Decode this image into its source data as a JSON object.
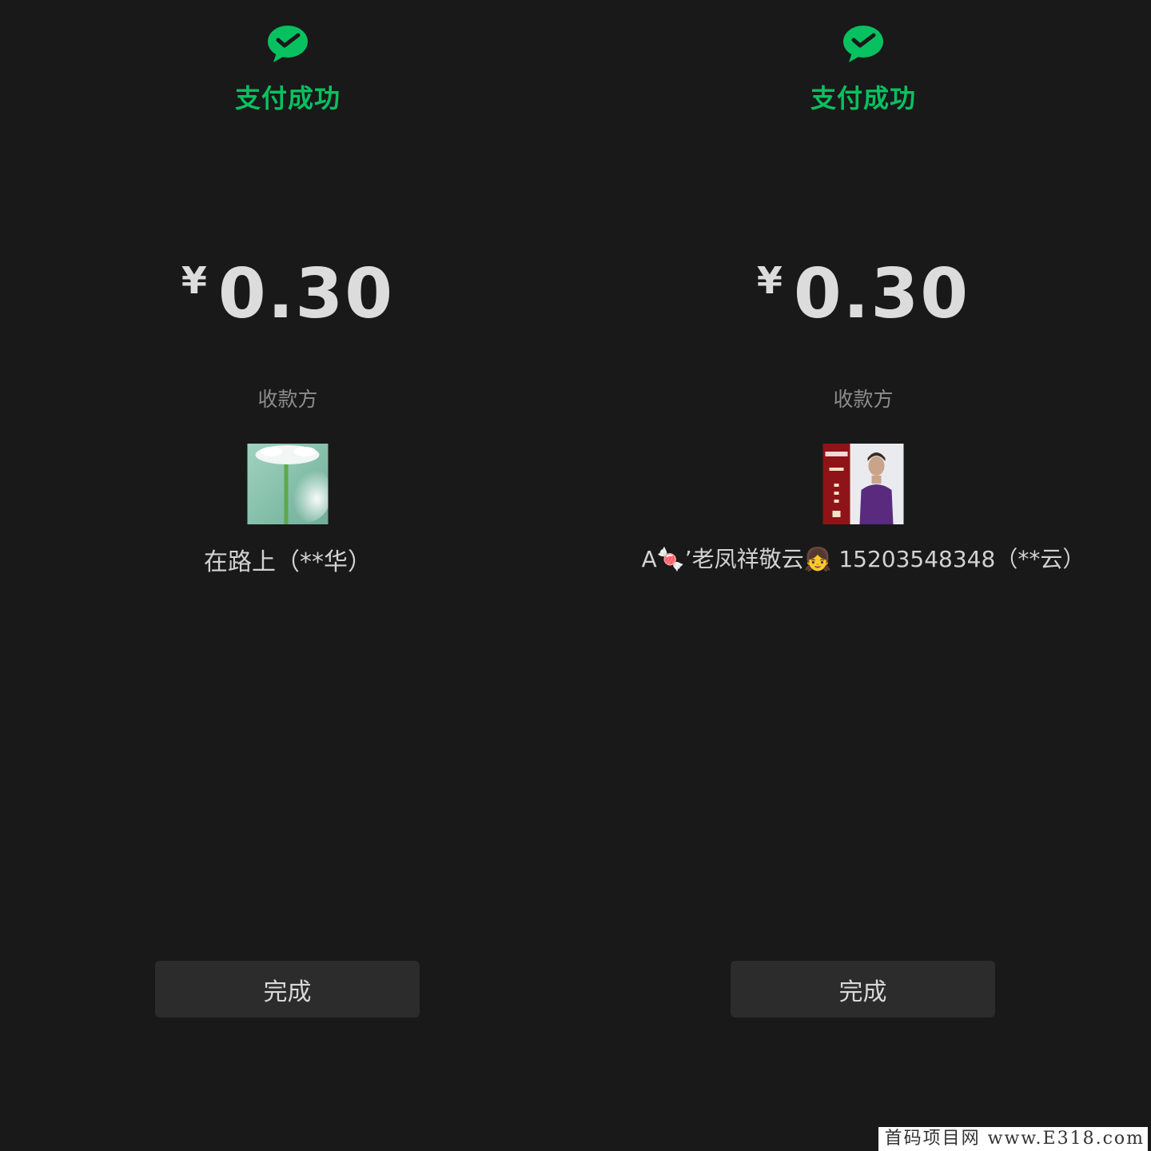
{
  "colors": {
    "background": "#191919",
    "success_green": "#07c160",
    "button_bg": "#2c2c2c",
    "label_gray": "#8c8c8c"
  },
  "left": {
    "icon": "wechat-pay-check-icon",
    "title": "支付成功",
    "currency": "¥",
    "amount": "0.30",
    "payee_label": "收款方",
    "payee_avatar": "flower-avatar",
    "payee_name": "在路上（**华）",
    "done_label": "完成"
  },
  "right": {
    "icon": "wechat-pay-check-icon",
    "title": "支付成功",
    "currency": "¥",
    "amount": "0.30",
    "payee_label": "收款方",
    "payee_avatar": "portrait-avatar",
    "payee_name": "A🍬’老凤祥敬云👧 15203548348（**云）",
    "done_label": "完成"
  },
  "watermark": "首码项目网 www.E318.com"
}
